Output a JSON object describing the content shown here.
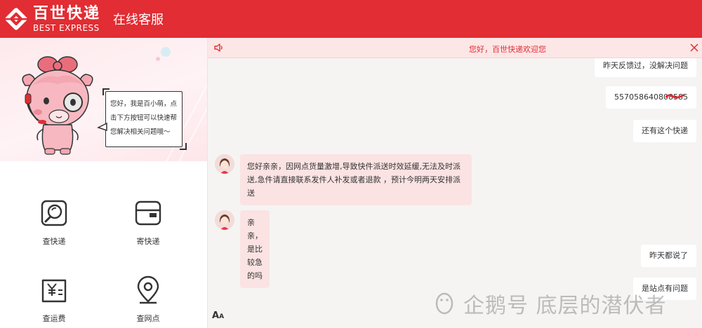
{
  "header": {
    "brand_cn": "百世快递",
    "brand_en": "BEST EXPRESS",
    "title": "在线客服",
    "color": "#e12d33"
  },
  "banner": {
    "bubble_lines": [
      "您好，我是百小萌，点",
      "击下方按钮可以快速帮",
      "您解决相关问题哦～"
    ]
  },
  "functions": [
    {
      "label": "查快递",
      "icon": "magnifier-box-icon"
    },
    {
      "label": "寄快递",
      "icon": "parcel-box-icon"
    },
    {
      "label": "查运费",
      "icon": "yuan-bill-icon"
    },
    {
      "label": "查网点",
      "icon": "map-pin-icon"
    }
  ],
  "notice": {
    "text": "您好，百世快递欢迎您",
    "icon": "speaker-icon",
    "close_icon": "close-icon"
  },
  "chat": {
    "messages": [
      {
        "side": "user",
        "text": "昨天反馈过，没解决问题"
      },
      {
        "side": "user",
        "text": "557058640808585"
      },
      {
        "side": "user",
        "text": "还有这个快递"
      },
      {
        "side": "agent",
        "lines": [
          "您好亲亲，因网点货量激增,导致快件派送时效延缓,无法及时派",
          "送,急件请直接联系发件人补发或者退款 ，预计今明两天安排派",
          "送"
        ]
      },
      {
        "side": "agent",
        "lines": [
          "亲亲，是比较急的吗"
        ]
      },
      {
        "side": "user",
        "text": "昨天都说了"
      },
      {
        "side": "user",
        "text": "是站点有问题"
      }
    ],
    "font_button": "A",
    "font_button_sub": "A"
  },
  "watermark": {
    "text": "企鹅号 底层的潜伏者"
  }
}
